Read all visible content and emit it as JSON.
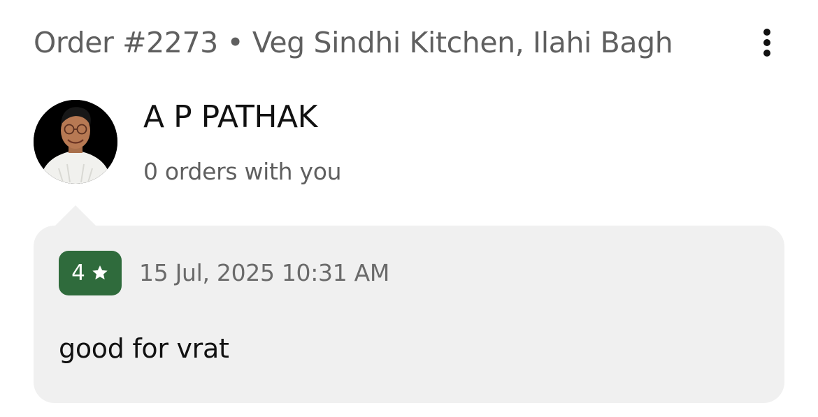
{
  "header": {
    "title": "Order #2273 • Veg Sindhi Kitchen, Ilahi Bagh",
    "menu_icon": "more-vertical-icon"
  },
  "customer": {
    "name": "A P PATHAK",
    "order_summary": "0 orders with you",
    "avatar_icon": "customer-avatar"
  },
  "review": {
    "rating": "4",
    "rating_icon": "star-icon",
    "date": "15 Jul, 2025 10:31 AM",
    "text": "good for vrat"
  },
  "colors": {
    "rating_badge_bg": "#2f6b3c",
    "card_bg": "#f0f0f0",
    "secondary_text": "#5f5f5f"
  }
}
